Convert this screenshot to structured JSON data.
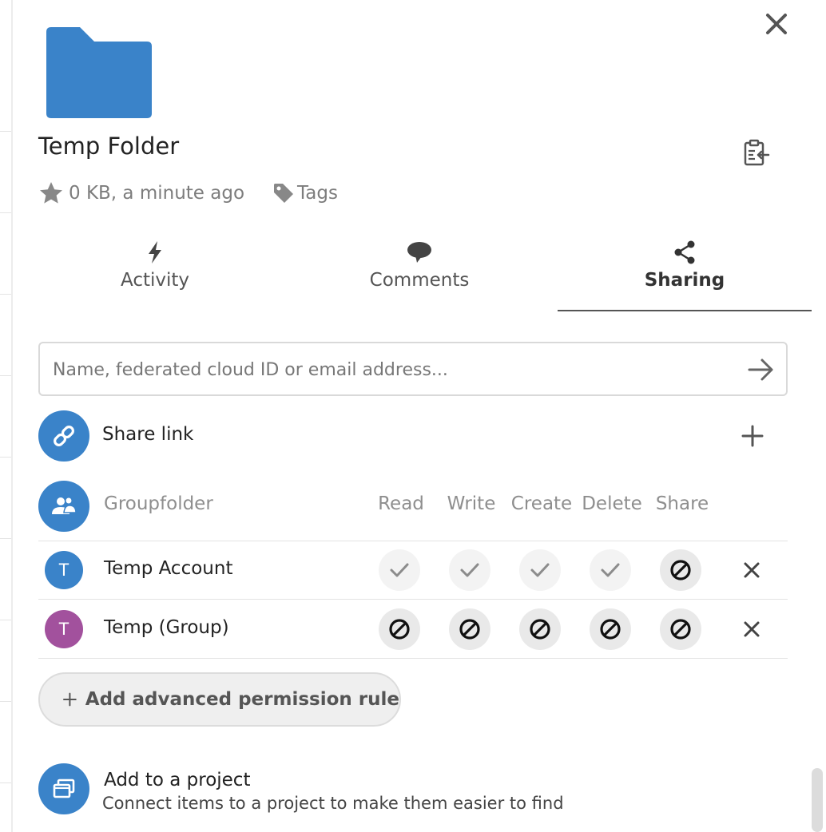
{
  "header": {
    "title": "Temp Folder",
    "meta": "0 KB, a minute ago",
    "tags_label": "Tags",
    "folder_color": "#3a83c9"
  },
  "tabs": [
    {
      "label": "Activity",
      "icon": "lightning-icon",
      "active": false
    },
    {
      "label": "Comments",
      "icon": "speech-bubble-icon",
      "active": false
    },
    {
      "label": "Sharing",
      "icon": "share-icon",
      "active": true
    }
  ],
  "sharing": {
    "input_placeholder": "Name, federated cloud ID or email address...",
    "share_link_label": "Share link"
  },
  "groupfolder": {
    "label": "Groupfolder",
    "columns": [
      "Read",
      "Write",
      "Create",
      "Delete",
      "Share"
    ],
    "rows": [
      {
        "initial": "T",
        "name": "Temp Account",
        "avatar_color": "#3a83c9",
        "permissions": [
          "allowed",
          "allowed",
          "allowed",
          "allowed",
          "denied"
        ]
      },
      {
        "initial": "T",
        "name": "Temp (Group)",
        "avatar_color": "#a2519d",
        "permissions": [
          "denied",
          "denied",
          "denied",
          "denied",
          "denied"
        ]
      }
    ],
    "add_rule_label": "Add advanced permission rule"
  },
  "project": {
    "title": "Add to a project",
    "subtitle": "Connect items to a project to make them easier to find"
  },
  "colors": {
    "accent": "#3a83c9",
    "group_avatar": "#a2519d",
    "muted_text": "#8e8e8e"
  }
}
